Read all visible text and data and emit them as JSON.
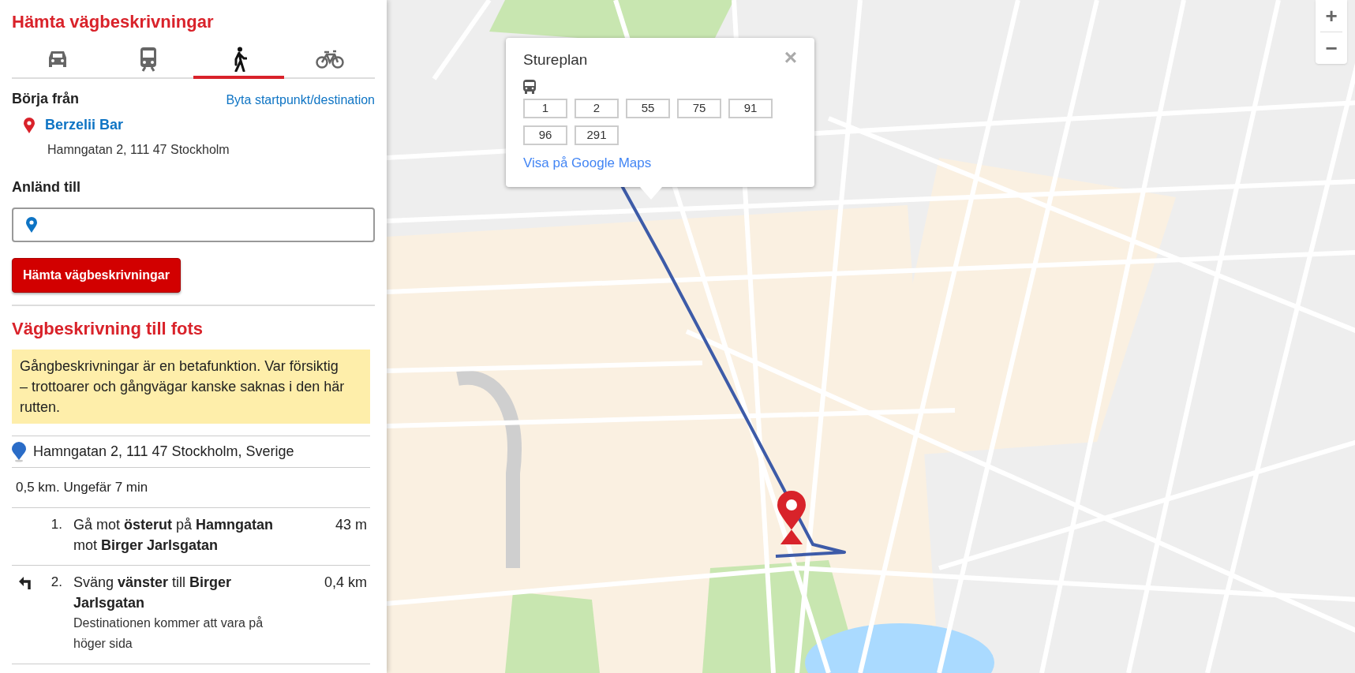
{
  "sidebar": {
    "title": "Hämta vägbeskrivningar",
    "modes": [
      {
        "kind": "car",
        "selected": false
      },
      {
        "kind": "transit",
        "selected": false
      },
      {
        "kind": "walk",
        "selected": true
      },
      {
        "kind": "bike",
        "selected": false
      }
    ],
    "start_label": "Börja från",
    "swap_link": "Byta startpunkt/destination",
    "start_name": "Berzelii Bar",
    "start_address": "Hamngatan 2, 111 47 Stockholm",
    "destination_label": "Anländ till",
    "submit_button": "Hämta vägbeskrivningar",
    "directions_title": "Vägbeskrivning till fots",
    "warning": "Gångbeskrivningar är en betafunktion. Var försiktig – trottoarer och gångvägar kanske saknas i den här rutten.",
    "origin": "Hamngatan 2, 111 47 Stockholm, Sverige",
    "summary": "0,5 km. Ungefär 7 min",
    "steps": [
      {
        "kind": "straight",
        "number": "1.",
        "text": "Gå mot **österut** på **Hamngatan** mot **Birger Jarlsgatan**",
        "distance": "43 m"
      },
      {
        "kind": "turn-left",
        "number": "2.",
        "text": "Sväng **vänster** till **Birger Jarlsgatan**",
        "note": "Destinationen kommer att vara på höger sida",
        "distance": "0,4 km"
      }
    ]
  },
  "map": {
    "zoom_in": "+",
    "zoom_out": "−",
    "popup": {
      "title": "Stureplan",
      "close": "×",
      "lines": [
        "1",
        "2",
        "55",
        "75",
        "91",
        "96",
        "291"
      ],
      "link": "Visa på Google Maps"
    }
  }
}
